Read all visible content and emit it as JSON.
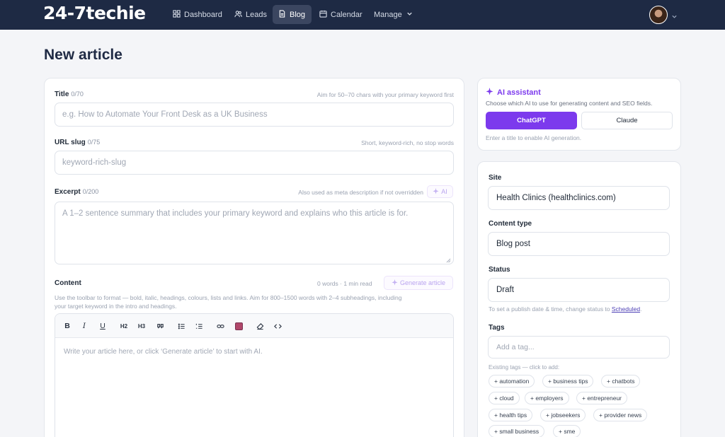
{
  "app": {
    "brand": "24-7techie",
    "nav": [
      {
        "label": "Dashboard",
        "icon": "grid-icon",
        "active": false
      },
      {
        "label": "Leads",
        "icon": "users-icon",
        "active": false
      },
      {
        "label": "Blog",
        "icon": "document-icon",
        "active": true
      },
      {
        "label": "Calendar",
        "icon": "calendar-icon",
        "active": false
      },
      {
        "label": "Manage",
        "icon": "chevron-down-icon",
        "active": false
      }
    ]
  },
  "page": {
    "title": "New article"
  },
  "form": {
    "title": {
      "label": "Title",
      "count": "0/70",
      "hint": "Aim for 50–70 chars with your primary keyword first",
      "placeholder": "e.g. How to Automate Your Front Desk as a UK Business"
    },
    "slug": {
      "label": "URL slug",
      "count": "0/75",
      "hint": "Short, keyword-rich, no stop words",
      "placeholder": "keyword-rich-slug"
    },
    "excerpt": {
      "label": "Excerpt",
      "count": "0/200",
      "hint": "Also used as meta description if not overridden",
      "ai_label": "AI",
      "placeholder": "A 1–2 sentence summary that includes your primary keyword and explains who this article is for."
    },
    "content": {
      "label": "Content",
      "stats": "0 words · 1 min read",
      "generate_label": "Generate article",
      "description_line1": "Use the toolbar to format — bold, italic, headings, colours, lists and links. Aim for 800–1500 words with 2–4 subheadings, including",
      "description_line2": "your target keyword in the intro and headings.",
      "placeholder": "Write your article here, or click ‘Generate article’ to start with AI.",
      "toolbar": {
        "bold": "B",
        "italic": "I",
        "underline": "U",
        "h2": "H2",
        "h3": "H3",
        "color": "#b0476a"
      }
    }
  },
  "ai": {
    "title": "AI assistant",
    "subtitle": "Choose which AI to use for generating content and SEO fields.",
    "chatgpt_label": "ChatGPT",
    "claude_label": "Claude",
    "note": "Enter a title to enable AI generation."
  },
  "sidebar": {
    "site": {
      "label": "Site",
      "value": "Health Clinics (healthclinics.com)"
    },
    "content_type": {
      "label": "Content type",
      "value": "Blog post"
    },
    "status": {
      "label": "Status",
      "value": "Draft",
      "note_prefix": "To set a publish date & time, change status to ",
      "note_link": "Scheduled",
      "note_suffix": "."
    },
    "tags": {
      "label": "Tags",
      "placeholder": "Add a tag...",
      "hint": "Existing tags — click to add:",
      "items": [
        "+ automation",
        "+ business tips",
        "+ chatbots",
        "+ cloud",
        "+ employers",
        "+ entrepreneur",
        "+ health tips",
        "+ jobseekers",
        "+ provider news",
        "+ small business",
        "+ sme"
      ]
    }
  },
  "colors": {
    "nav_bg": "#1e2a44",
    "accent": "#7c3aed",
    "page_bg": "#f4f5f8"
  }
}
